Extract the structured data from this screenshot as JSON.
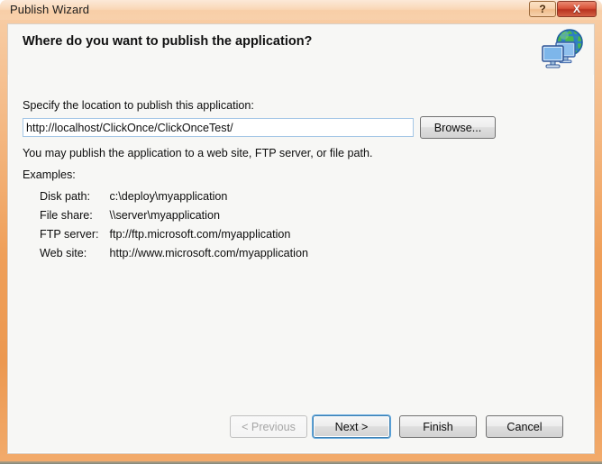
{
  "window": {
    "title": "Publish Wizard",
    "help_label": "?",
    "close_label": "X",
    "titlebar_color": "#ef9f59",
    "client_bg": "#f7f7f5"
  },
  "header": {
    "title": "Where do you want to publish the application?",
    "icon": "network-globe-icon"
  },
  "main": {
    "location_label": "Specify the location to publish this application:",
    "location_value": "http://localhost/ClickOnce/ClickOnceTest/",
    "location_placeholder": "",
    "browse_label": "Browse...",
    "info_text": "You may publish the application to a web site, FTP server, or file path.",
    "examples_label": "Examples:",
    "examples": [
      {
        "key": "Disk path:",
        "value": "c:\\deploy\\myapplication"
      },
      {
        "key": "File share:",
        "value": "\\\\server\\myapplication"
      },
      {
        "key": "FTP server:",
        "value": "ftp://ftp.microsoft.com/myapplication"
      },
      {
        "key": "Web site:",
        "value": "http://www.microsoft.com/myapplication"
      }
    ]
  },
  "footer": {
    "previous_label": "< Previous",
    "next_label": "Next >",
    "finish_label": "Finish",
    "cancel_label": "Cancel",
    "default_button_accent": "#3c7fb1"
  }
}
